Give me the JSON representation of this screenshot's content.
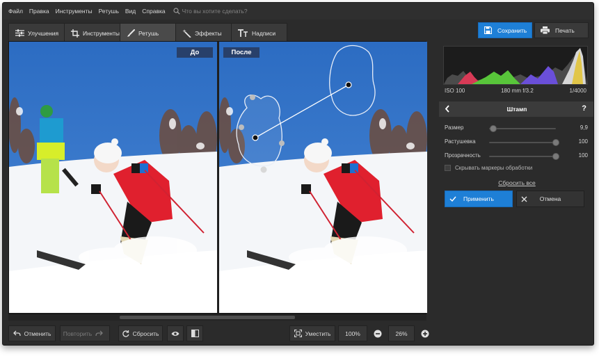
{
  "menu": {
    "items": [
      "Файл",
      "Правка",
      "Инструменты",
      "Ретушь",
      "Вид",
      "Справка"
    ],
    "search_placeholder": "Что вы хотите сделать?",
    "search_icon": "search-icon"
  },
  "tabs": [
    {
      "label": "Улучшения",
      "icon": "sliders-icon",
      "active": false
    },
    {
      "label": "Инструменты",
      "icon": "crop-icon",
      "active": false
    },
    {
      "label": "Ретушь",
      "icon": "brush-icon",
      "active": true
    },
    {
      "label": "Эффекты",
      "icon": "magic-wand-icon",
      "active": false
    },
    {
      "label": "Надписи",
      "icon": "text-icon",
      "active": false
    }
  ],
  "actions": {
    "save_label": "Сохранить",
    "print_label": "Печать"
  },
  "canvas": {
    "before_label": "До",
    "after_label": "После"
  },
  "bottom": {
    "undo_label": "Отменить",
    "redo_label": "Повторить",
    "reset_label": "Сбросить",
    "fit_label": "Уместить",
    "zoom_100_label": "100%",
    "zoom_value": "26%"
  },
  "info": {
    "iso": "ISO 100",
    "lens": "180 mm f/3.2",
    "shutter": "1/4000"
  },
  "panel": {
    "title": "Штамп",
    "help": "?",
    "sliders": [
      {
        "label": "Размер",
        "value": "9,9",
        "fraction": 0.06
      },
      {
        "label": "Растушевка",
        "value": "100",
        "fraction": 1.0
      },
      {
        "label": "Прозрачность",
        "value": "100",
        "fraction": 1.0
      }
    ],
    "hide_markers_label": "Скрывать маркеры обработки",
    "hide_markers_checked": false,
    "reset_all_label": "Сбросить все",
    "apply_label": "Применить",
    "cancel_label": "Отмена"
  },
  "colors": {
    "accent": "#1e7fd6",
    "background": "#2b2b2b",
    "label_bg": "#28406a",
    "sky": "#2f6fc4",
    "jacket": "#e0202e"
  }
}
